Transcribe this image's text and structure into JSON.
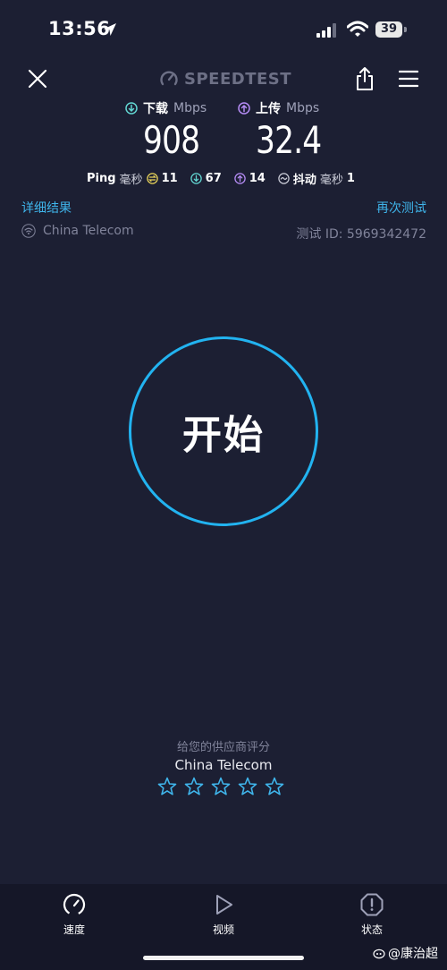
{
  "status_bar": {
    "time": "13:56",
    "battery": "39"
  },
  "header": {
    "brand": "SPEEDTEST"
  },
  "results": {
    "download": {
      "label": "下载",
      "unit": "Mbps",
      "value": "908"
    },
    "upload": {
      "label": "上传",
      "unit": "Mbps",
      "value": "32.4"
    },
    "ping": {
      "label": "Ping",
      "unit": "毫秒",
      "idle": "11",
      "download": "67",
      "upload": "14"
    },
    "jitter": {
      "label": "抖动",
      "unit": "毫秒",
      "value": "1"
    }
  },
  "links": {
    "details": "详细结果",
    "retest": "再次测试"
  },
  "connection": {
    "isp": "China Telecom",
    "test_id": "测试 ID: 5969342472"
  },
  "go_button": {
    "label": "开始"
  },
  "rating": {
    "prompt": "给您的供应商评分",
    "isp": "China Telecom",
    "max_stars": 5,
    "selected": 0
  },
  "nav": {
    "speed": "速度",
    "video": "视频",
    "status": "状态"
  },
  "watermark": "@康治超",
  "colors": {
    "background": "#1c1f33",
    "accent": "#22b3f0",
    "download": "#62d6d2",
    "upload": "#b58cf5",
    "idle_ping": "#e8d35a"
  }
}
